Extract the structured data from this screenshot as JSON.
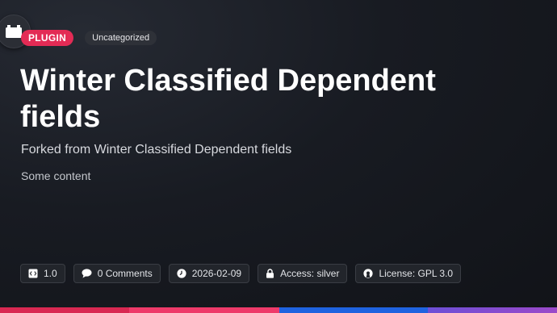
{
  "header": {
    "icon": "plugin-block-icon",
    "type_badge": "PLUGIN",
    "category_badge": "Uncategorized"
  },
  "title": "Winter Classified Dependent fields",
  "subtitle": "Forked from Winter Classified Dependent fields",
  "content": "Some content",
  "meta": {
    "version": "1.0",
    "comments": "0 Comments",
    "date": "2026-02-09",
    "access": "Access: silver",
    "license": "License: GPL 3.0"
  },
  "colors": {
    "accent": "#e32b55",
    "bar_segments": [
      "#d92852",
      "#ee3a6a",
      "#1f63e0",
      "#8a4bd0"
    ]
  }
}
